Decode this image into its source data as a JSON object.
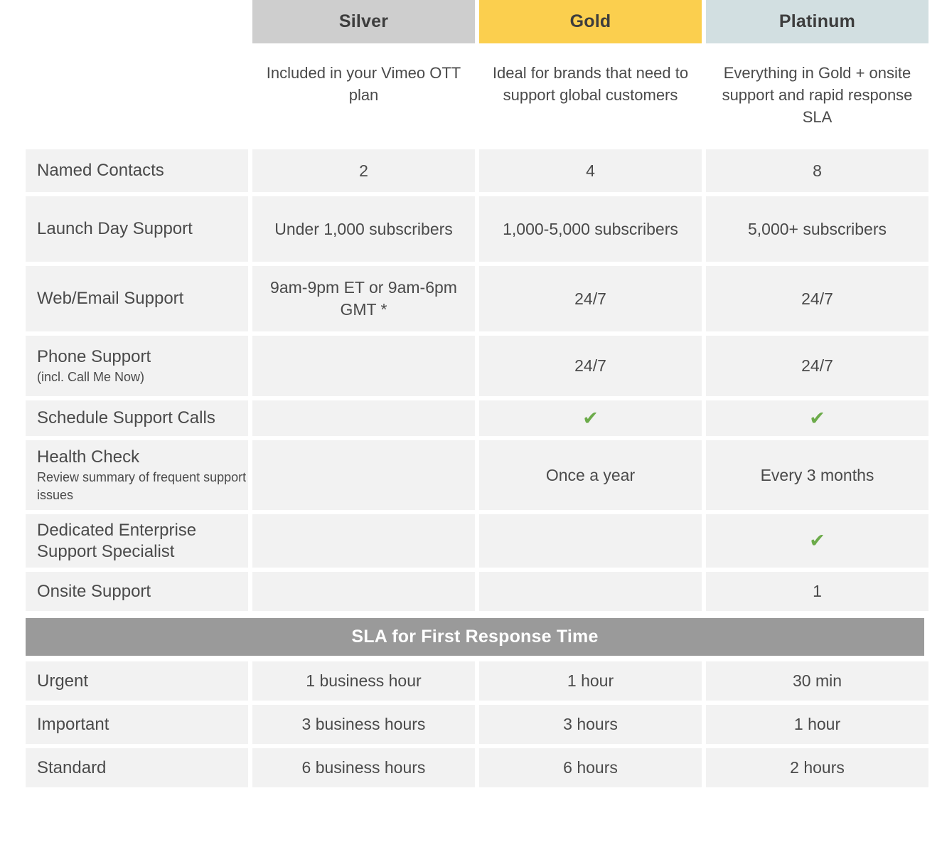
{
  "plans": [
    {
      "name": "Silver",
      "color": "#cecece",
      "description": "Included in your Vimeo OTT plan"
    },
    {
      "name": "Gold",
      "color": "#fbcf4e",
      "description": "Ideal for brands that need to support global customers"
    },
    {
      "name": "Platinum",
      "color": "#d2dfe1",
      "description": "Everything in Gold + onsite support and rapid response SLA"
    }
  ],
  "features": [
    {
      "label": "Named Contacts",
      "sublabel": "",
      "silver": "2",
      "gold": "4",
      "platinum": "8"
    },
    {
      "label": "Launch Day Support",
      "sublabel": "",
      "silver": "Under 1,000 subscribers",
      "gold": "1,000-5,000 subscribers",
      "platinum": "5,000+ subscribers"
    },
    {
      "label": "Web/Email Support",
      "sublabel": "",
      "silver": "9am-9pm ET or 9am-6pm GMT *",
      "gold": "24/7",
      "platinum": "24/7"
    },
    {
      "label": "Phone Support",
      "sublabel": "(incl. Call Me Now)",
      "silver": "",
      "gold": "24/7",
      "platinum": "24/7"
    },
    {
      "label": "Schedule Support Calls",
      "sublabel": "",
      "silver": "",
      "gold": "check",
      "platinum": "check"
    },
    {
      "label": "Health Check",
      "sublabel": "Review summary of frequent support issues",
      "silver": "",
      "gold": "Once a year",
      "platinum": "Every 3 months"
    },
    {
      "label": "Dedicated Enterprise Support Specialist",
      "sublabel": "",
      "silver": "",
      "gold": "",
      "platinum": "check"
    },
    {
      "label": "Onsite Support",
      "sublabel": "",
      "silver": "",
      "gold": "",
      "platinum": "1"
    }
  ],
  "sla": {
    "banner_title": "SLA for First Response Time",
    "rows": [
      {
        "label": "Urgent",
        "silver": "1 business hour",
        "gold": "1 hour",
        "platinum": "30 min"
      },
      {
        "label": "Important",
        "silver": "3 business hours",
        "gold": "3 hours",
        "platinum": "1 hour"
      },
      {
        "label": "Standard",
        "silver": "6 business hours",
        "gold": "6 hours",
        "platinum": "2 hours"
      }
    ]
  },
  "icons": {
    "check_glyph": "✔"
  },
  "colors": {
    "silver": "#cecece",
    "gold": "#fbcf4e",
    "platinum": "#d2dfe1",
    "cell_background": "#f2f2f2",
    "banner_gray": "#9a9a9a",
    "check_green": "#6cab4a",
    "text": "#4a4a4a"
  }
}
